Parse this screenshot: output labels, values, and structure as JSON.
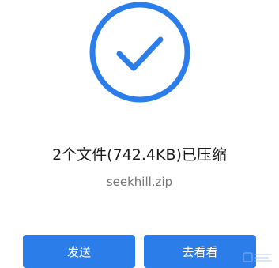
{
  "status": {
    "headline": "2个文件(742.4KB)已压缩",
    "filename": "seekhill.zip",
    "icon": "check-circle-icon",
    "accent_color": "#2b7de9"
  },
  "actions": {
    "send_label": "发送",
    "view_label": "去看看"
  }
}
